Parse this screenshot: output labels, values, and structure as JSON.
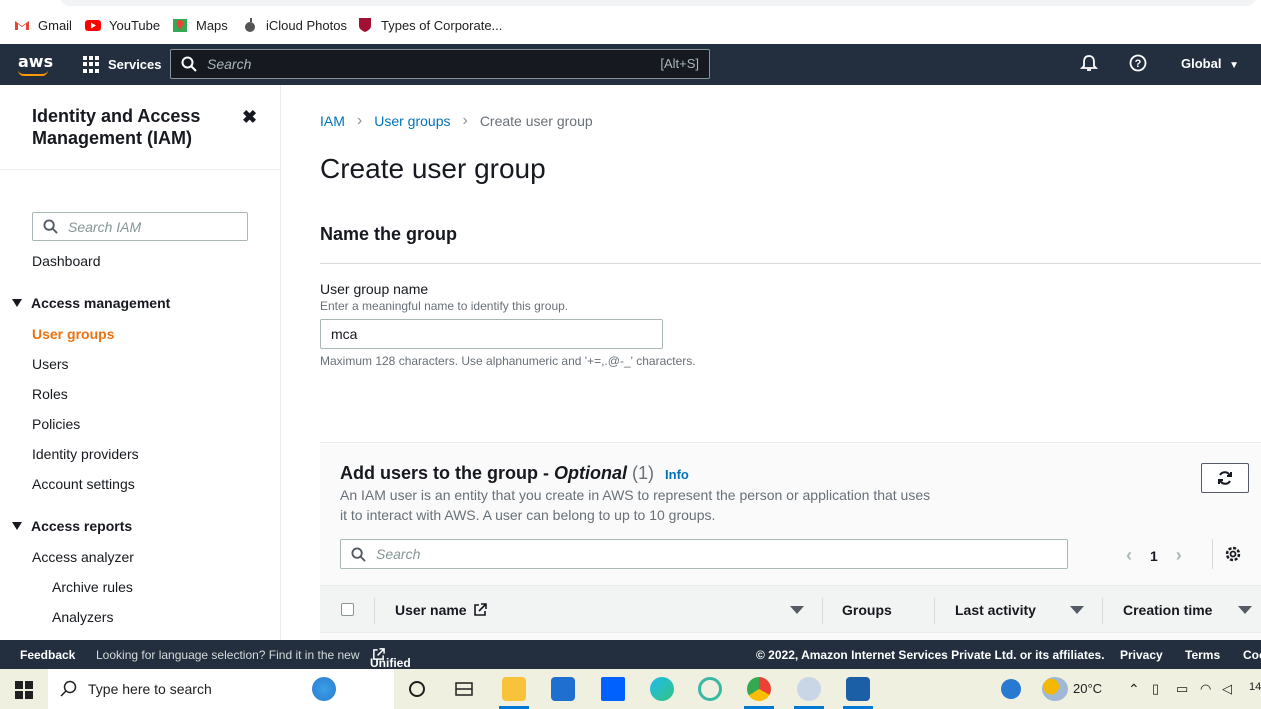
{
  "bookmarks": [
    {
      "label": "Gmail",
      "icon": "gmail-icon"
    },
    {
      "label": "YouTube",
      "icon": "youtube-icon"
    },
    {
      "label": "Maps",
      "icon": "maps-icon"
    },
    {
      "label": "iCloud Photos",
      "icon": "apple-icon"
    },
    {
      "label": "Types of Corporate...",
      "icon": "harvard-icon"
    }
  ],
  "topnav": {
    "logo": "aws",
    "services_label": "Services",
    "search_placeholder": "Search",
    "search_shortcut": "[Alt+S]",
    "region": "Global"
  },
  "sidebar": {
    "title": "Identity and Access Management (IAM)",
    "search_placeholder": "Search IAM",
    "dashboard": "Dashboard",
    "access_management": "Access management",
    "am_items": [
      "User groups",
      "Users",
      "Roles",
      "Policies",
      "Identity providers",
      "Account settings"
    ],
    "access_reports": "Access reports",
    "ar_items": [
      "Access analyzer"
    ],
    "ar_sub_items": [
      "Archive rules",
      "Analyzers"
    ]
  },
  "breadcrumb": {
    "root": "IAM",
    "parent": "User groups",
    "current": "Create user group"
  },
  "page": {
    "title": "Create user group",
    "section_title": "Name the group",
    "field_label": "User group name",
    "field_desc": "Enter a meaningful name to identify this group.",
    "field_value": "mca",
    "field_hint": "Maximum 128 characters. Use alphanumeric and '+=,.@-_' characters."
  },
  "users_panel": {
    "title_prefix": "Add users to the group - ",
    "title_optional": "Optional",
    "count": "(1)",
    "info": "Info",
    "description": "An IAM user is an entity that you create in AWS to represent the person or application that uses it to interact with AWS. A user can belong to up to 10 groups.",
    "search_placeholder": "Search",
    "page_number": "1",
    "columns": [
      "User name",
      "Groups",
      "Last activity",
      "Creation time"
    ]
  },
  "footer": {
    "feedback": "Feedback",
    "language_text": "Looking for language selection? Find it in the new",
    "unified_settings": "Unified Settings",
    "copyright": "© 2022, Amazon Internet Services Private Ltd. or its affiliates.",
    "privacy": "Privacy",
    "terms": "Terms",
    "cookie": "Coo"
  },
  "taskbar": {
    "search_placeholder": "Type here to search",
    "temperature": "20°C",
    "clock_partial": "14"
  },
  "colors": {
    "aws_nav": "#232f3e",
    "aws_orange": "#ec7211",
    "link_blue": "#0073bb"
  }
}
